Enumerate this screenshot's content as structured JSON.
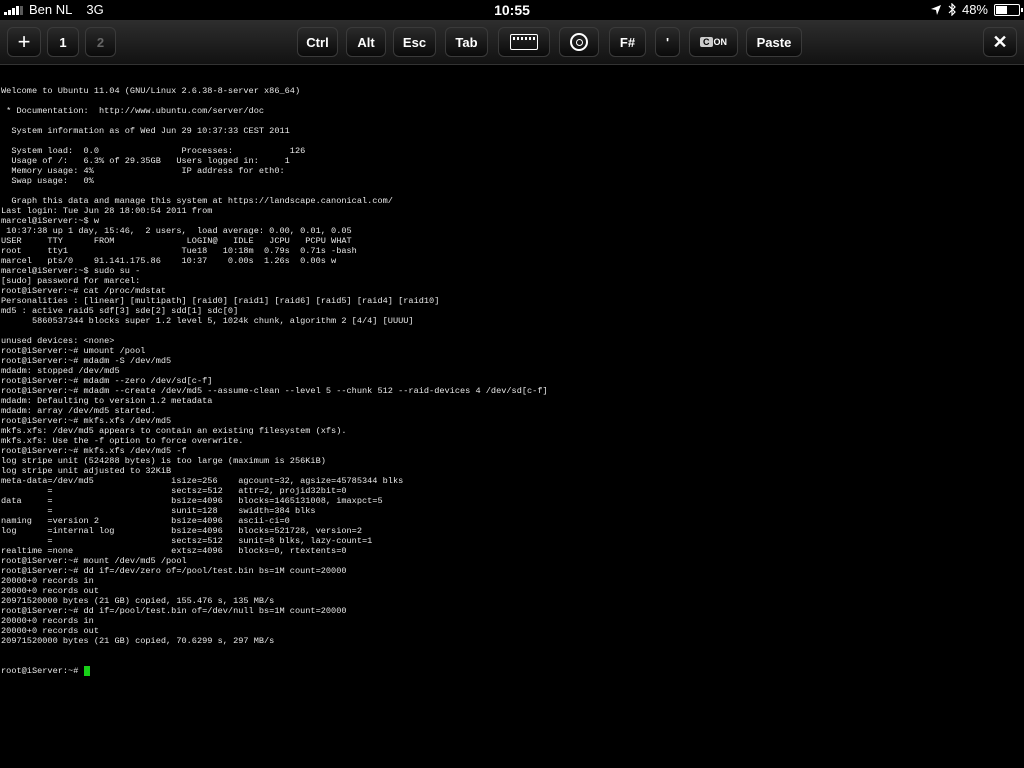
{
  "status": {
    "carrier": "Ben NL",
    "network": "3G",
    "time": "10:55",
    "battery_label": "48%",
    "battery_level": 0.48
  },
  "toolbar": {
    "add_label": "+",
    "tab1_label": "1",
    "tab2_label": "2",
    "ctrl_label": "Ctrl",
    "alt_label": "Alt",
    "esc_label": "Esc",
    "tab_label": "Tab",
    "fsharp_label": "F#",
    "tick_label": "'",
    "ctrl_on_box": "C",
    "ctrl_on_label": "ON",
    "paste_label": "Paste",
    "close_label": "✕"
  },
  "terminal": {
    "lines": [
      "Welcome to Ubuntu 11.04 (GNU/Linux 2.6.38-8-server x86_64)",
      "",
      " * Documentation:  http://www.ubuntu.com/server/doc",
      "",
      "  System information as of Wed Jun 29 10:37:33 CEST 2011",
      "",
      "  System load:  0.0                Processes:           126",
      "  Usage of /:   6.3% of 29.35GB   Users logged in:     1",
      "  Memory usage: 4%                 IP address for eth0:",
      "  Swap usage:   0%",
      "",
      "  Graph this data and manage this system at https://landscape.canonical.com/",
      "Last login: Tue Jun 28 18:00:54 2011 from",
      "marcel@iServer:~$ w",
      " 10:37:38 up 1 day, 15:46,  2 users,  load average: 0.00, 0.01, 0.05",
      "USER     TTY      FROM              LOGIN@   IDLE   JCPU   PCPU WHAT",
      "root     tty1                      Tue18   10:18m  0.79s  0.71s -bash",
      "marcel   pts/0    91.141.175.86    10:37    0.00s  1.26s  0.00s w",
      "marcel@iServer:~$ sudo su -",
      "[sudo] password for marcel:",
      "root@iServer:~# cat /proc/mdstat",
      "Personalities : [linear] [multipath] [raid0] [raid1] [raid6] [raid5] [raid4] [raid10]",
      "md5 : active raid5 sdf[3] sde[2] sdd[1] sdc[0]",
      "      5860537344 blocks super 1.2 level 5, 1024k chunk, algorithm 2 [4/4] [UUUU]",
      "",
      "unused devices: <none>",
      "root@iServer:~# umount /pool",
      "root@iServer:~# mdadm -S /dev/md5",
      "mdadm: stopped /dev/md5",
      "root@iServer:~# mdadm --zero /dev/sd[c-f]",
      "root@iServer:~# mdadm --create /dev/md5 --assume-clean --level 5 --chunk 512 --raid-devices 4 /dev/sd[c-f]",
      "mdadm: Defaulting to version 1.2 metadata",
      "mdadm: array /dev/md5 started.",
      "root@iServer:~# mkfs.xfs /dev/md5",
      "mkfs.xfs: /dev/md5 appears to contain an existing filesystem (xfs).",
      "mkfs.xfs: Use the -f option to force overwrite.",
      "root@iServer:~# mkfs.xfs /dev/md5 -f",
      "log stripe unit (524288 bytes) is too large (maximum is 256KiB)",
      "log stripe unit adjusted to 32KiB",
      "meta-data=/dev/md5               isize=256    agcount=32, agsize=45785344 blks",
      "         =                       sectsz=512   attr=2, projid32bit=0",
      "data     =                       bsize=4096   blocks=1465131008, imaxpct=5",
      "         =                       sunit=128    swidth=384 blks",
      "naming   =version 2              bsize=4096   ascii-ci=0",
      "log      =internal log           bsize=4096   blocks=521728, version=2",
      "         =                       sectsz=512   sunit=8 blks, lazy-count=1",
      "realtime =none                   extsz=4096   blocks=0, rtextents=0",
      "root@iServer:~# mount /dev/md5 /pool",
      "root@iServer:~# dd if=/dev/zero of=/pool/test.bin bs=1M count=20000",
      "20000+0 records in",
      "20000+0 records out",
      "20971520000 bytes (21 GB) copied, 155.476 s, 135 MB/s",
      "root@iServer:~# dd if=/pool/test.bin of=/dev/null bs=1M count=20000",
      "20000+0 records in",
      "20000+0 records out",
      "20971520000 bytes (21 GB) copied, 70.6299 s, 297 MB/s"
    ],
    "prompt": "root@iServer:~# "
  }
}
